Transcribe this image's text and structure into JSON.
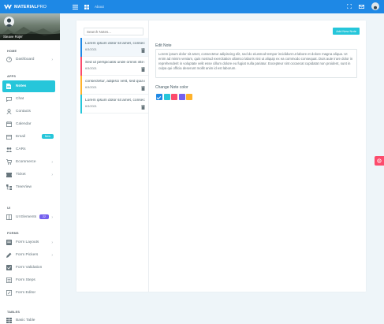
{
  "topbar": {
    "brand_bold": "MATERIAL",
    "brand_thin": "PRO",
    "about": "About",
    "icons": [
      "menu-icon",
      "grid-icon",
      "fullscreen-icon",
      "mail-icon",
      "user-avatar"
    ]
  },
  "sidebar": {
    "profile_name": "Steave Rojer",
    "sections": {
      "home": "HOME",
      "apps": "APPS",
      "ui": "UI",
      "forms": "FORMS",
      "tables": "TABLES"
    },
    "items": {
      "dashboard": "Dashboard",
      "notes": "Notes",
      "chat": "Chat",
      "contacts": "Contacts",
      "calendar": "Calendar",
      "email": "Email",
      "email_badge": "New",
      "cars": "CARs",
      "ecommerce": "Ecommerce",
      "ticket": "Ticket",
      "treeview": "TreeView",
      "ui_elements": "UI Elements",
      "ui_badge": "22",
      "form_layouts": "Form Layouts",
      "form_pickers": "Form Pickers",
      "form_validation": "Form Validation",
      "form_steps": "Form Steps",
      "form_editor": "Form Editor",
      "basic_table": "Basic Table"
    }
  },
  "notes_app": {
    "search_placeholder": "Search Notes...",
    "add_button": "Add New Note",
    "edit_label": "Edit Note",
    "edit_text": "Lorem ipsum dolor sit amet, consectetur adipiscing elit, sed do eiusmod tempor incididunt ut labore et dolore magna aliqua. Ut enim ad minim veniam, quis nostrud exercitation ullamco laboris nisi ut aliquip ex ea commodo consequat. Duis aute irure dolor in reprehenderit in voluptate velit esse cillum dolore eu fugiat nulla pariatur. Excepteur sint occaecat cupidatat non proident, sunt in culpa qui officia deserunt mollit anim id est laborum.",
    "color_label": "Change Note color",
    "notes": [
      {
        "title": "Lorem ipsum dolor sit amet, consectetur adipiscing elit",
        "date": "6/3/2021",
        "color": "#1e88e5"
      },
      {
        "title": "Sed ut perspiciatis unde omnis iste natus",
        "date": "6/3/2021",
        "color": "#fc4b6c"
      },
      {
        "title": "consectetur, adipisci velit, sed quia non",
        "date": "6/3/2021",
        "color": "#ffb22b"
      },
      {
        "title": "Lorem ipsum dolor sit amet, consectetur adipiscing elit",
        "date": "6/3/2021",
        "color": "#26c6da"
      }
    ],
    "swatches": [
      "#1e88e5",
      "#26c6da",
      "#fc4b6c",
      "#7460ee",
      "#ffb22b"
    ]
  },
  "colors": {
    "primary": "#1e88e5",
    "cyan": "#26c6da",
    "red": "#fc4b6c",
    "purple": "#7460ee",
    "orange": "#ffb22b"
  }
}
